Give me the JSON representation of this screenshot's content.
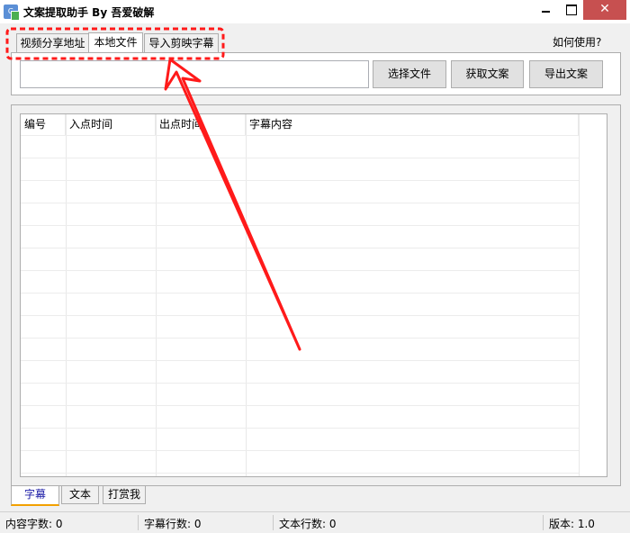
{
  "window": {
    "title": "文案提取助手 By 吾爱破解",
    "icon_name": "app-icon",
    "close_symbol": "✕"
  },
  "tabs": [
    {
      "label": "视频分享地址",
      "active": false
    },
    {
      "label": "本地文件",
      "active": true
    },
    {
      "label": "导入剪映字幕",
      "active": false
    }
  ],
  "help_link": "如何使用?",
  "file_input": {
    "value": "",
    "placeholder": ""
  },
  "buttons": {
    "select_file": "选择文件",
    "get_text": "获取文案",
    "export_text": "导出文案"
  },
  "table": {
    "columns": [
      "编号",
      "入点时间",
      "出点时间",
      "字幕内容"
    ],
    "rows": []
  },
  "bottom_tabs": [
    {
      "label": "字幕",
      "active": true
    },
    {
      "label": "文本",
      "active": false
    },
    {
      "label": "打赏我",
      "active": false
    }
  ],
  "status": {
    "content_chars": "内容字数: 0",
    "subtitle_lines": "字幕行数: 0",
    "text_lines": "文本行数: 0",
    "version": "版本: 1.0"
  },
  "colors": {
    "annotation_red": "#ff1a1a",
    "close_button": "#c75050",
    "active_tab_underline": "#f2a000"
  }
}
